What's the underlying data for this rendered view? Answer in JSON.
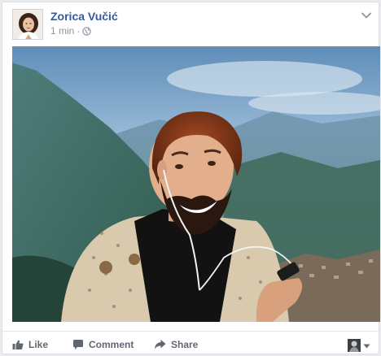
{
  "post": {
    "author": "Zorica Vučić",
    "timestamp": "1 min",
    "separator": "·",
    "privacy_icon": "globe-icon"
  },
  "actions": {
    "like": "Like",
    "comment": "Comment",
    "share": "Share"
  },
  "icons": {
    "options": "chevron-down-icon",
    "like": "thumbs-up-icon",
    "comment": "speech-bubble-icon",
    "share": "share-arrow-icon",
    "reactor_dropdown": "caret-down-icon"
  },
  "colors": {
    "author_link": "#365899",
    "meta_text": "#90949c",
    "action_text": "#616770",
    "background": "#e9ebee"
  }
}
